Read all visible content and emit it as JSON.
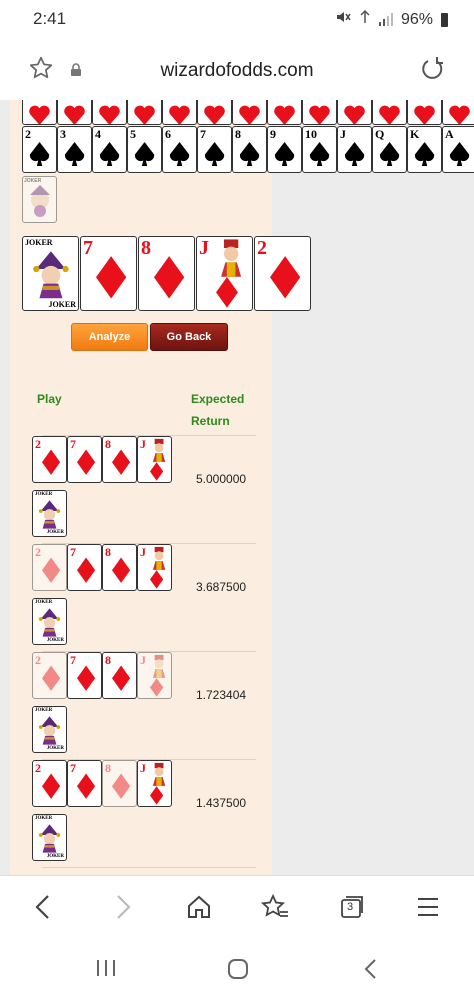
{
  "status": {
    "time": "2:41",
    "battery": "96%"
  },
  "browser": {
    "url": "wizardofodds.com",
    "tab_count": "3"
  },
  "deck_ranks": [
    "2",
    "3",
    "4",
    "5",
    "6",
    "7",
    "8",
    "9",
    "10",
    "J",
    "Q",
    "K",
    "A"
  ],
  "hand": {
    "cards": [
      {
        "rank": "JOKER",
        "suit": "joker"
      },
      {
        "rank": "7",
        "suit": "diamonds"
      },
      {
        "rank": "8",
        "suit": "diamonds"
      },
      {
        "rank": "J",
        "suit": "diamonds"
      },
      {
        "rank": "2",
        "suit": "diamonds"
      }
    ]
  },
  "buttons": {
    "analyze": "Analyze",
    "go_back": "Go Back"
  },
  "table": {
    "col_play": "Play",
    "col_expected_1": "Expected",
    "col_expected_2": "Return",
    "rows": [
      {
        "expected": "5.000000",
        "held": [
          true,
          true,
          true,
          true,
          true
        ]
      },
      {
        "expected": "3.687500",
        "held": [
          false,
          true,
          true,
          true,
          true
        ]
      },
      {
        "expected": "1.723404",
        "held": [
          false,
          true,
          true,
          false,
          true
        ]
      },
      {
        "expected": "1.437500",
        "held": [
          true,
          true,
          false,
          true,
          true
        ]
      }
    ]
  },
  "joker_label": "JOKER",
  "colors": {
    "red": "#e8101a",
    "green_header": "#2e8b1c",
    "panel_bg": "#fbeee0"
  }
}
